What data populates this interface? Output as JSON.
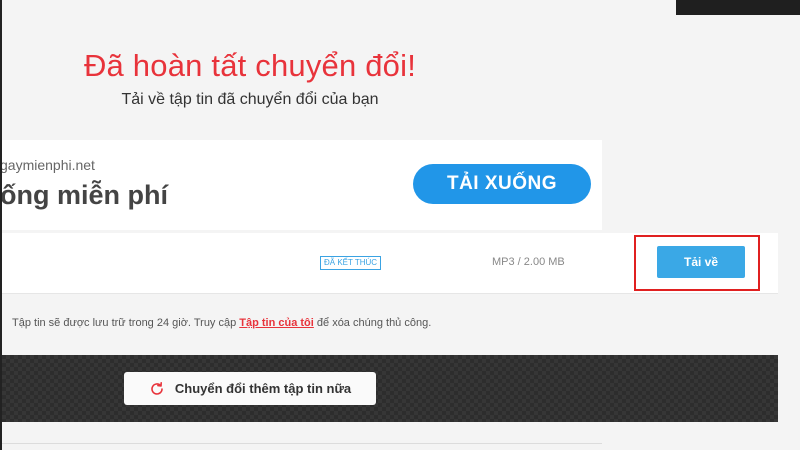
{
  "header": {
    "title": "Đã hoàn tất chuyển đổi!",
    "subtitle": "Tải về tập tin đã chuyển đổi của bạn"
  },
  "ad": {
    "domain": "gaymienphi.net",
    "tagline": "ống miễn phí",
    "button_label": "TẢI XUỐNG"
  },
  "file_row": {
    "status": "ĐÃ KẾT THÚC",
    "meta": "MP3 / 2.00 MB",
    "download_label": "Tải về"
  },
  "notice": {
    "before": "Tập tin sẽ được lưu trữ trong 24 giờ. Truy cập ",
    "link": "Tập tin của tôi",
    "after": " để xóa chúng thủ công."
  },
  "actions": {
    "convert_more_label": "Chuyển đổi thêm tập tin nữa"
  },
  "colors": {
    "accent_red": "#e8333b",
    "accent_blue": "#3aa8e6",
    "highlight_box": "#e02020"
  }
}
